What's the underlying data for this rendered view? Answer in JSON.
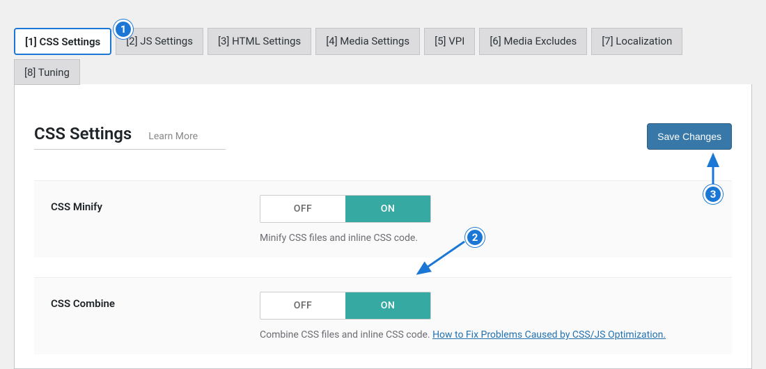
{
  "tabs": {
    "items": [
      {
        "label": "[1] CSS Settings",
        "active": true
      },
      {
        "label": "[2] JS Settings"
      },
      {
        "label": "[3] HTML Settings"
      },
      {
        "label": "[4] Media Settings"
      },
      {
        "label": "[5] VPI"
      },
      {
        "label": "[6] Media Excludes"
      },
      {
        "label": "[7] Localization"
      },
      {
        "label": "[8] Tuning"
      }
    ]
  },
  "panel": {
    "title": "CSS Settings",
    "learn_more": "Learn More",
    "save_label": "Save Changes"
  },
  "settings": [
    {
      "label": "CSS Minify",
      "off": "OFF",
      "on": "ON",
      "state": "on",
      "desc": "Minify CSS files and inline CSS code.",
      "link": null
    },
    {
      "label": "CSS Combine",
      "off": "OFF",
      "on": "ON",
      "state": "on",
      "desc": "Combine CSS files and inline CSS code. ",
      "link": "How to Fix Problems Caused by CSS/JS Optimization."
    }
  ],
  "annotations": {
    "b1": "1",
    "b2": "2",
    "b3": "3"
  }
}
